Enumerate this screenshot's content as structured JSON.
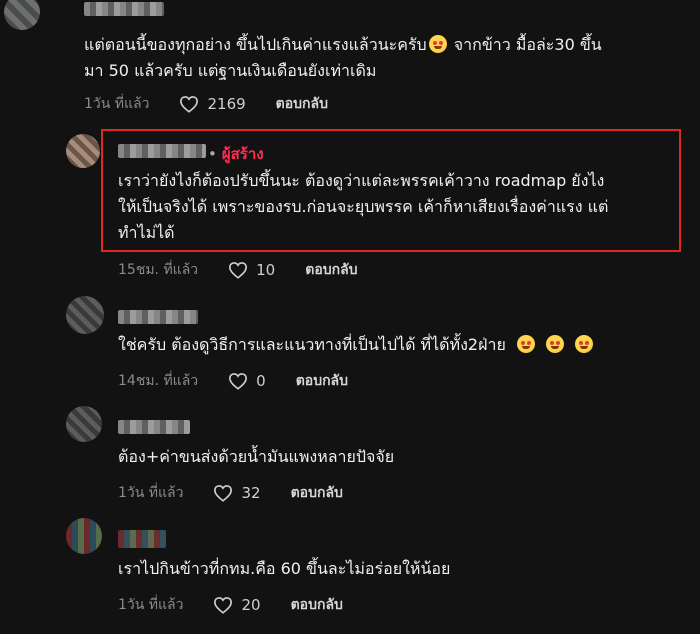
{
  "comments": [
    {
      "text_line1": "แต่ตอนนี้ของทุกอย่าง ขึ้นไปเกินค่าแรงแล้วนะครับ",
      "text_line1b": " จากข้าว มื้อล่ะ30 ขึ้น",
      "text_line2": "มา 50 แล้วครับ แต่ฐานเงินเดือนยังเท่าเดิม",
      "time": "1วัน ที่แล้ว",
      "likes": "2169",
      "reply": "ตอบกลับ"
    },
    {
      "badge": "ผู้สร้าง",
      "text_line1": "เราว่ายังไงก็ต้องปรับขึ้นนะ ต้องดูว่าแต่ละพรรคเค้าวาง roadmap ยังไง",
      "text_line2": "ให้เป็นจริงได้ เพราะของรบ.ก่อนจะยุบพรรค เค้าก็หาเสียงเรื่องค่าแรง แต่",
      "text_line3": "ทำไม่ได้",
      "time": "15ชม. ที่แล้ว",
      "likes": "10",
      "reply": "ตอบกลับ"
    },
    {
      "text_line1": "ใช่ครับ ต้องดูวิธีการและแนวทางที่เป็นไปได้ ที่ได้ทั้ง2ฝ่าย",
      "time": "14ชม. ที่แล้ว",
      "likes": "0",
      "reply": "ตอบกลับ"
    },
    {
      "text_line1": "ต้อง+ค่าขนส่งด้วยน้ำมันแพงหลายปัจจัย",
      "time": "1วัน ที่แล้ว",
      "likes": "32",
      "reply": "ตอบกลับ"
    },
    {
      "text_line1": "เราไปกินข้าวที่กทม.คือ 60 ขึ้นละไม่อร่อยให้น้อย",
      "time": "1วัน ที่แล้ว",
      "likes": "20",
      "reply": "ตอบกลับ"
    }
  ],
  "icons": {
    "like": "heart-outline-icon",
    "emoji": "smiling-face-with-hearts-icon"
  },
  "colors": {
    "background": "#121212",
    "creator_badge": "#fe2c55",
    "highlight_box": "#e12525"
  }
}
